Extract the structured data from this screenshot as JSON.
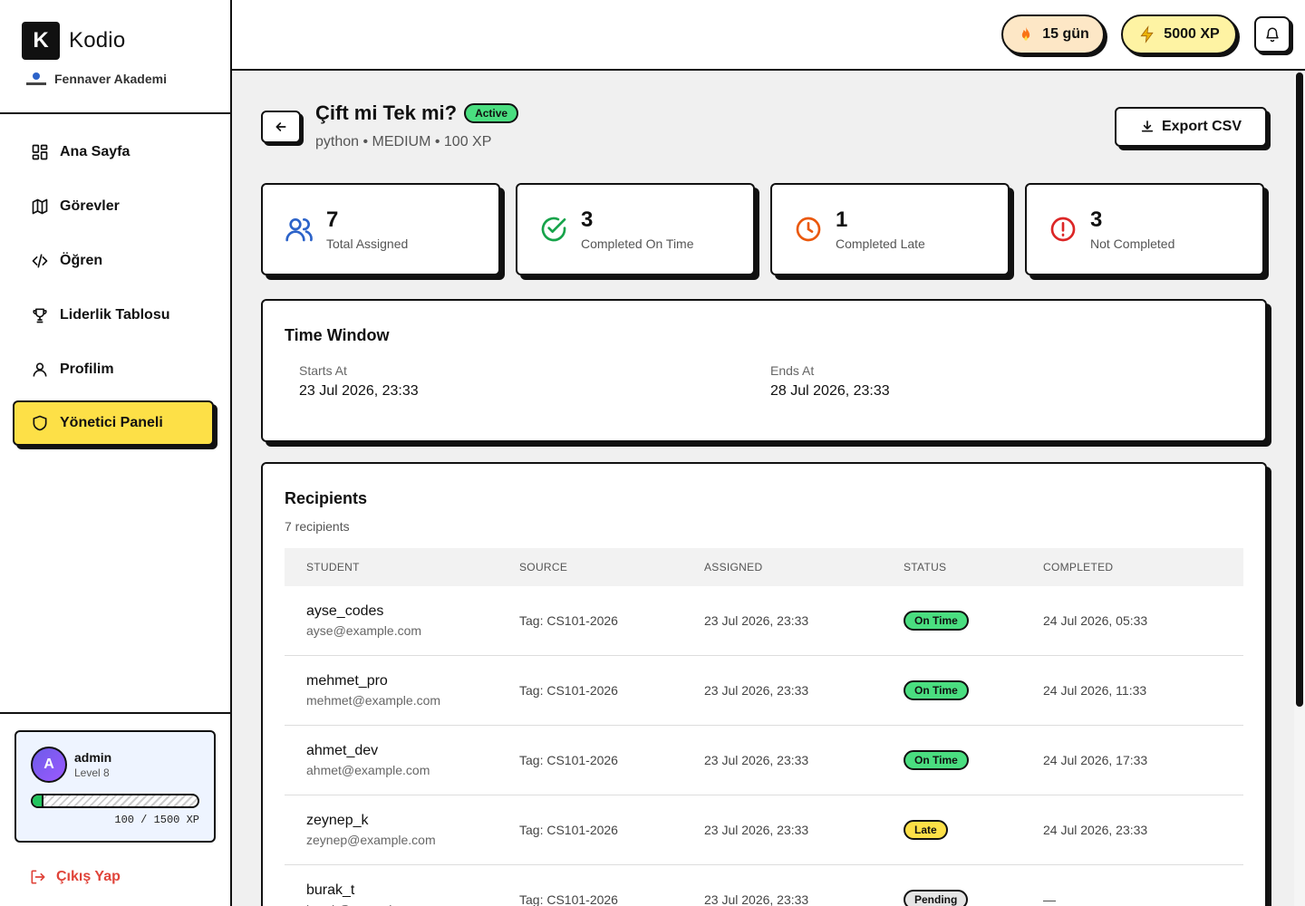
{
  "sidebar": {
    "logo_letter": "K",
    "app_name": "Kodio",
    "org_name": "Fennaver Akademi",
    "items": [
      {
        "label": "Ana Sayfa",
        "icon": "grid-icon"
      },
      {
        "label": "Görevler",
        "icon": "map-icon"
      },
      {
        "label": "Öğren",
        "icon": "code-icon"
      },
      {
        "label": "Liderlik Tablosu",
        "icon": "trophy-icon"
      },
      {
        "label": "Profilim",
        "icon": "user-icon"
      },
      {
        "label": "Yönetici Paneli",
        "icon": "shield-icon",
        "active": true
      }
    ],
    "user": {
      "initial": "A",
      "name": "admin",
      "level": "Level 8",
      "xp_progress": 0.067,
      "xp_text": "100 / 1500 XP"
    },
    "logout_label": "Çıkış Yap"
  },
  "topbar": {
    "streak": "15 gün",
    "xp": "5000 XP"
  },
  "header": {
    "title": "Çift mi Tek mi?",
    "status": "Active",
    "subtitle": "python • MEDIUM • 100 XP",
    "export_label": "Export CSV"
  },
  "stats": [
    {
      "value": "7",
      "label": "Total Assigned",
      "icon": "users-icon",
      "color": "#2c63c9"
    },
    {
      "value": "3",
      "label": "Completed On Time",
      "icon": "check-circle-icon",
      "color": "#16a34a"
    },
    {
      "value": "1",
      "label": "Completed Late",
      "icon": "clock-icon",
      "color": "#ea580c"
    },
    {
      "value": "3",
      "label": "Not Completed",
      "icon": "alert-circle-icon",
      "color": "#dc2626"
    }
  ],
  "time_window": {
    "title": "Time Window",
    "starts_label": "Starts At",
    "starts_value": "23 Jul 2026, 23:33",
    "ends_label": "Ends At",
    "ends_value": "28 Jul 2026, 23:33"
  },
  "recipients": {
    "title": "Recipients",
    "count_text": "7 recipients",
    "columns": [
      "STUDENT",
      "SOURCE",
      "ASSIGNED",
      "STATUS",
      "COMPLETED"
    ],
    "rows": [
      {
        "name": "ayse_codes",
        "email": "ayse@example.com",
        "source": "Tag: CS101-2026",
        "assigned": "23 Jul 2026, 23:33",
        "status": "On Time",
        "completed": "24 Jul 2026, 05:33"
      },
      {
        "name": "mehmet_pro",
        "email": "mehmet@example.com",
        "source": "Tag: CS101-2026",
        "assigned": "23 Jul 2026, 23:33",
        "status": "On Time",
        "completed": "24 Jul 2026, 11:33"
      },
      {
        "name": "ahmet_dev",
        "email": "ahmet@example.com",
        "source": "Tag: CS101-2026",
        "assigned": "23 Jul 2026, 23:33",
        "status": "On Time",
        "completed": "24 Jul 2026, 17:33"
      },
      {
        "name": "zeynep_k",
        "email": "zeynep@example.com",
        "source": "Tag: CS101-2026",
        "assigned": "23 Jul 2026, 23:33",
        "status": "Late",
        "completed": "24 Jul 2026, 23:33"
      },
      {
        "name": "burak_t",
        "email": "burak@example.com",
        "source": "Tag: CS101-2026",
        "assigned": "23 Jul 2026, 23:33",
        "status": "Pending",
        "completed": "—"
      }
    ]
  }
}
